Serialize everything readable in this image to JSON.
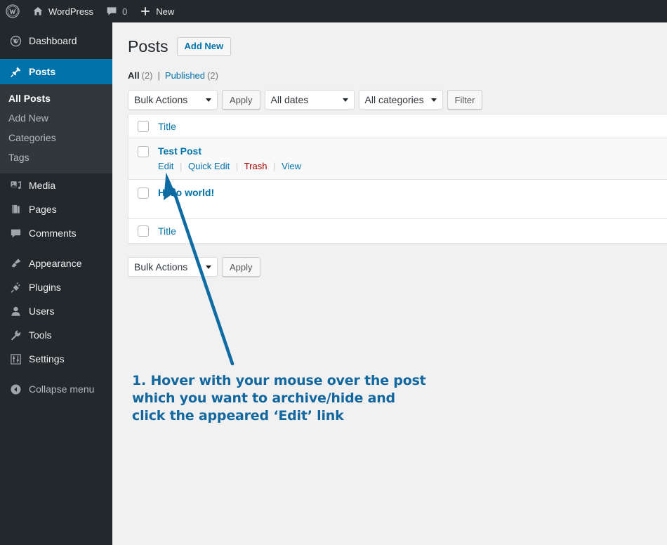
{
  "adminbar": {
    "logo_icon": "wordpress-logo-icon",
    "site_name": "WordPress",
    "home_icon": "home-icon",
    "comments_icon": "comment-bubble-icon",
    "comments_count": "0",
    "new_icon": "plus-icon",
    "new_label": "New"
  },
  "sidebar": {
    "items": [
      {
        "label": "Dashboard",
        "icon": "dashboard-icon",
        "current": false
      },
      {
        "label": "Posts",
        "icon": "pin-icon",
        "current": true
      },
      {
        "label": "Media",
        "icon": "media-icon",
        "current": false
      },
      {
        "label": "Pages",
        "icon": "pages-icon",
        "current": false
      },
      {
        "label": "Comments",
        "icon": "comment-bubble-icon",
        "current": false
      },
      {
        "label": "Appearance",
        "icon": "paintbrush-icon",
        "current": false
      },
      {
        "label": "Plugins",
        "icon": "plug-icon",
        "current": false
      },
      {
        "label": "Users",
        "icon": "user-icon",
        "current": false
      },
      {
        "label": "Tools",
        "icon": "wrench-icon",
        "current": false
      },
      {
        "label": "Settings",
        "icon": "sliders-icon",
        "current": false
      }
    ],
    "submenu": [
      {
        "label": "All Posts",
        "current": true
      },
      {
        "label": "Add New",
        "current": false
      },
      {
        "label": "Categories",
        "current": false
      },
      {
        "label": "Tags",
        "current": false
      }
    ],
    "collapse": {
      "label": "Collapse menu",
      "icon": "chevron-left-circle-icon"
    }
  },
  "page": {
    "title": "Posts",
    "add_new_label": "Add New"
  },
  "views": {
    "all_label": "All",
    "all_count": "(2)",
    "separator": "|",
    "published_label": "Published",
    "published_count": "(2)"
  },
  "tablenav_top": {
    "bulk_actions": "Bulk Actions",
    "apply_label": "Apply",
    "dates": "All dates",
    "categories": "All categories",
    "filter_label": "Filter"
  },
  "tablenav_bottom": {
    "bulk_actions": "Bulk Actions",
    "apply_label": "Apply"
  },
  "table": {
    "column_title": "Title",
    "rows": [
      {
        "title": "Test Post",
        "hovered": true,
        "actions": [
          {
            "label": "Edit",
            "kind": "edit"
          },
          {
            "label": "Quick Edit",
            "kind": "quick-edit"
          },
          {
            "label": "Trash",
            "kind": "trash"
          },
          {
            "label": "View",
            "kind": "view"
          }
        ]
      },
      {
        "title": "Hello world!",
        "hovered": false,
        "actions": []
      }
    ]
  },
  "annotation": {
    "line1": "1. Hover with your mouse over the post",
    "line2": "which you want to archive/hide and",
    "line3": "click the appeared ‘Edit’ link",
    "color": "#11679e",
    "arrow_color": "#0f6ca3"
  },
  "colors": {
    "sidebar_bg": "#23282d",
    "submenu_bg": "#32373c",
    "accent_blue": "#0073aa",
    "page_bg": "#f1f1f1",
    "trash_red": "#a00"
  }
}
